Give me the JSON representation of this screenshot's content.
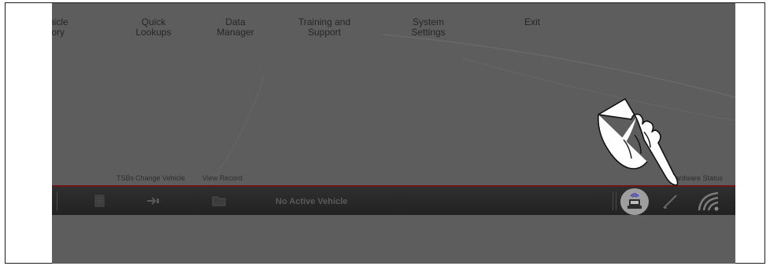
{
  "top_nav": {
    "items": [
      {
        "label": "hicle\ntory"
      },
      {
        "label": "Quick\nLookups"
      },
      {
        "label": "Data\nManager"
      },
      {
        "label": "Training and\nSupport"
      },
      {
        "label": "System\nSettings"
      },
      {
        "label": "Exit"
      }
    ]
  },
  "toolbar_labels": {
    "tsbs": "TSBs",
    "change_vehicle": "Change Vehicle",
    "view_record": "View Record",
    "hardware_status": "Hardware Status"
  },
  "status_bar": {
    "status_text": "No Active Vehicle"
  },
  "icons": {
    "tsb": "tsb-document-icon",
    "change_vehicle": "change-vehicle-arrow-icon",
    "view_record": "view-record-folder-icon",
    "hardware": "hardware-status-icon",
    "pen": "pen-icon",
    "signal": "wireless-signal-icon",
    "pointer": "pointing-hand-icon"
  },
  "colors": {
    "screen_bg": "#5d5d5d",
    "toolbar_bg": "#2a2a2a",
    "accent_line": "#6e1515",
    "hardware_button": "#9e9e9e"
  }
}
